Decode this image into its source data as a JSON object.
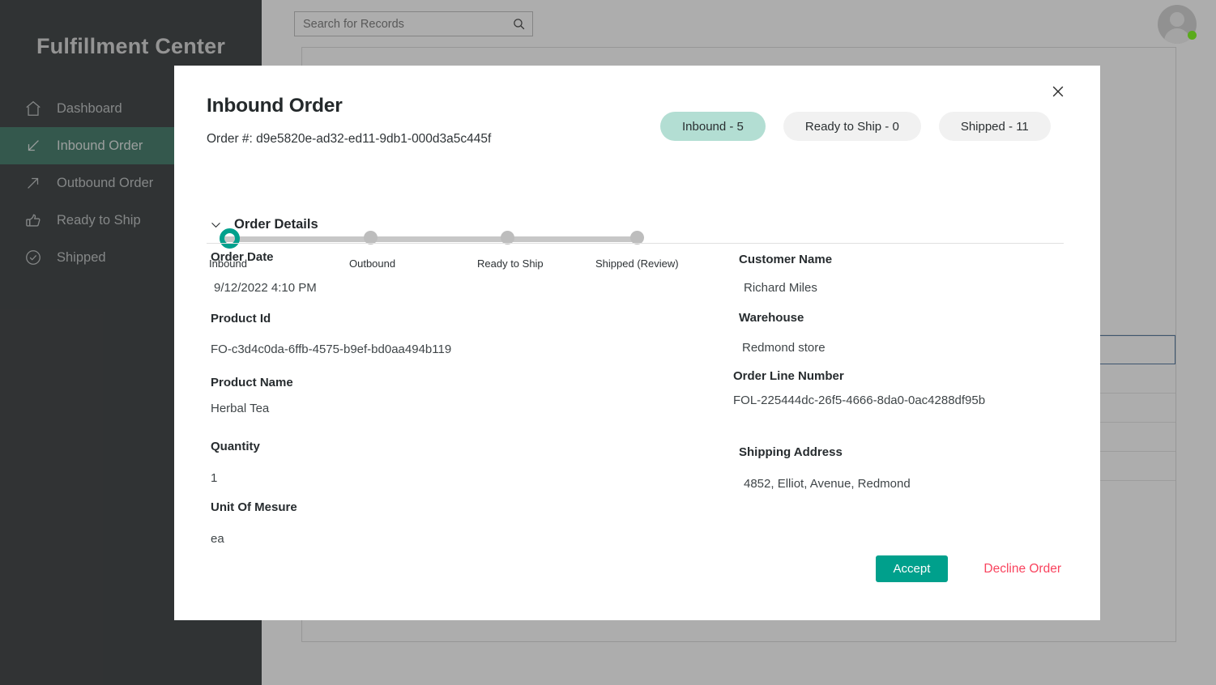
{
  "app": {
    "brand_title": "Fulfillment Center"
  },
  "search": {
    "placeholder": "Search for Records",
    "value": "",
    "icon": "search-icon"
  },
  "account": {
    "avatar_icon": "user-avatar-icon",
    "status": "online",
    "status_color": "#5aab1b"
  },
  "sidebar": {
    "items": [
      {
        "label": "Dashboard",
        "icon": "home-icon",
        "active": false
      },
      {
        "label": "Inbound Order",
        "icon": "arrow-down-left-icon",
        "active": true
      },
      {
        "label": "Outbound Order",
        "icon": "arrow-up-right-icon",
        "active": false
      },
      {
        "label": "Ready to Ship",
        "icon": "thumbs-up-icon",
        "active": false
      },
      {
        "label": "Shipped",
        "icon": "check-circle-icon",
        "active": false
      }
    ],
    "active_bg": "#2f6d5b",
    "bg": "#292d2f"
  },
  "modal": {
    "title": "Inbound Order",
    "order_number": "Order #: d9e5820e-ad32-ed11-9db1-000d3a5c445f",
    "close_icon": "close-icon",
    "status_pills": [
      {
        "label": "Inbound - 5",
        "active": true
      },
      {
        "label": "Ready to Ship - 0",
        "active": false
      },
      {
        "label": "Shipped - 11",
        "active": false
      }
    ],
    "active_pill_color": "#b3ded3",
    "stepper": {
      "steps": [
        {
          "label": "Inbound",
          "state": "current"
        },
        {
          "label": "Outbound",
          "state": "pending"
        },
        {
          "label": "Ready to Ship",
          "state": "pending"
        },
        {
          "label": "Shipped (Review)",
          "state": "pending"
        }
      ],
      "current_color": "#00a08c",
      "track_color": "#c7c7c7"
    },
    "details_section": {
      "toggle_label": "Order Details",
      "toggle_icon": "chevron-down-icon",
      "expanded": true,
      "left_fields": [
        {
          "label": "Order Date",
          "value": "9/12/2022 4:10 PM"
        },
        {
          "label": "Product Id",
          "value": "FO-c3d4c0da-6ffb-4575-b9ef-bd0aa494b119"
        },
        {
          "label": "Product Name",
          "value": "Herbal Tea"
        },
        {
          "label": "Quantity",
          "value": "1"
        },
        {
          "label": "Unit Of Mesure",
          "value": "ea"
        }
      ],
      "right_fields": [
        {
          "label": "Customer Name",
          "value": "Richard Miles"
        },
        {
          "label": "Warehouse",
          "value": "Redmond store"
        },
        {
          "label": "Order Line Number",
          "value": "FOL-225444dc-26f5-4666-8da0-0ac4288df95b"
        },
        {
          "label": "Shipping Address",
          "value": "4852, Elliot, Avenue, Redmond"
        }
      ]
    },
    "actions": {
      "accept_label": "Accept",
      "accept_color": "#00a08c",
      "decline_label": "Decline Order",
      "decline_color": "#f9435e"
    }
  },
  "background_list": {
    "row_count": 6,
    "selected_row_index": 1,
    "selected_border_color": "#3f6894"
  }
}
